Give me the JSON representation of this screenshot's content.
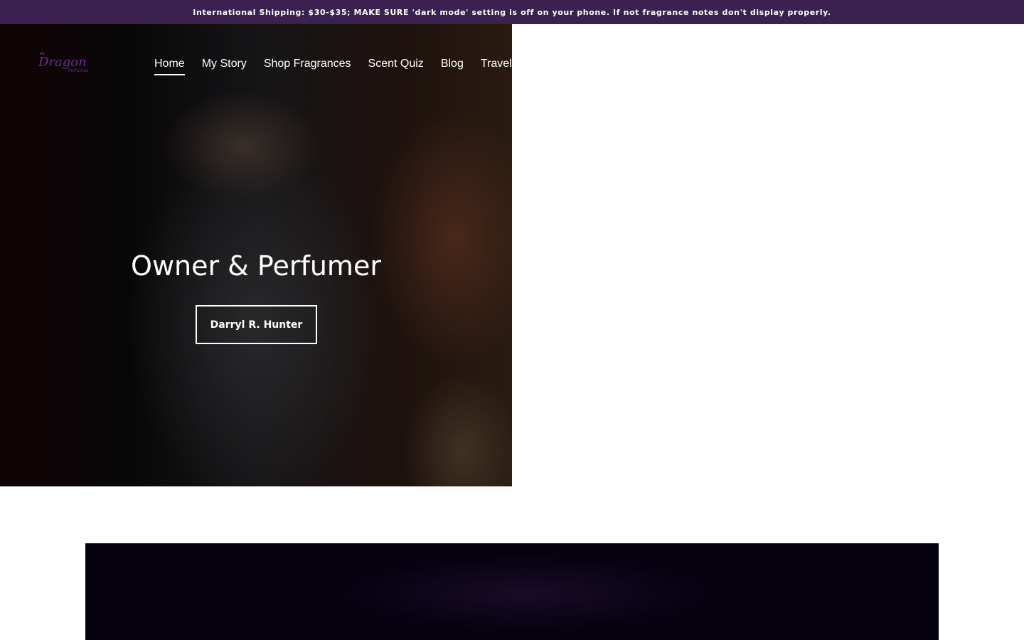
{
  "announcement": {
    "text": "International Shipping: $30-$35; MAKE SURE 'dark mode' setting is off on your phone. If not fragrance notes don't display properly."
  },
  "brand": {
    "logo_text": "Dragon",
    "logo_sub": "Perfumes",
    "logo_color": "#6a2c91"
  },
  "nav": {
    "items": [
      {
        "label": "Home",
        "active": true
      },
      {
        "label": "My Story"
      },
      {
        "label": "Shop Fragrances"
      },
      {
        "label": "Scent Quiz"
      },
      {
        "label": "Blog"
      },
      {
        "label": "Traveling"
      }
    ]
  },
  "hero": {
    "title": "Owner & Perfumer",
    "button_label": "Darryl R. Hunter"
  },
  "colors": {
    "announcement_bg": "#3a2150",
    "video_bg": "#05010f"
  }
}
